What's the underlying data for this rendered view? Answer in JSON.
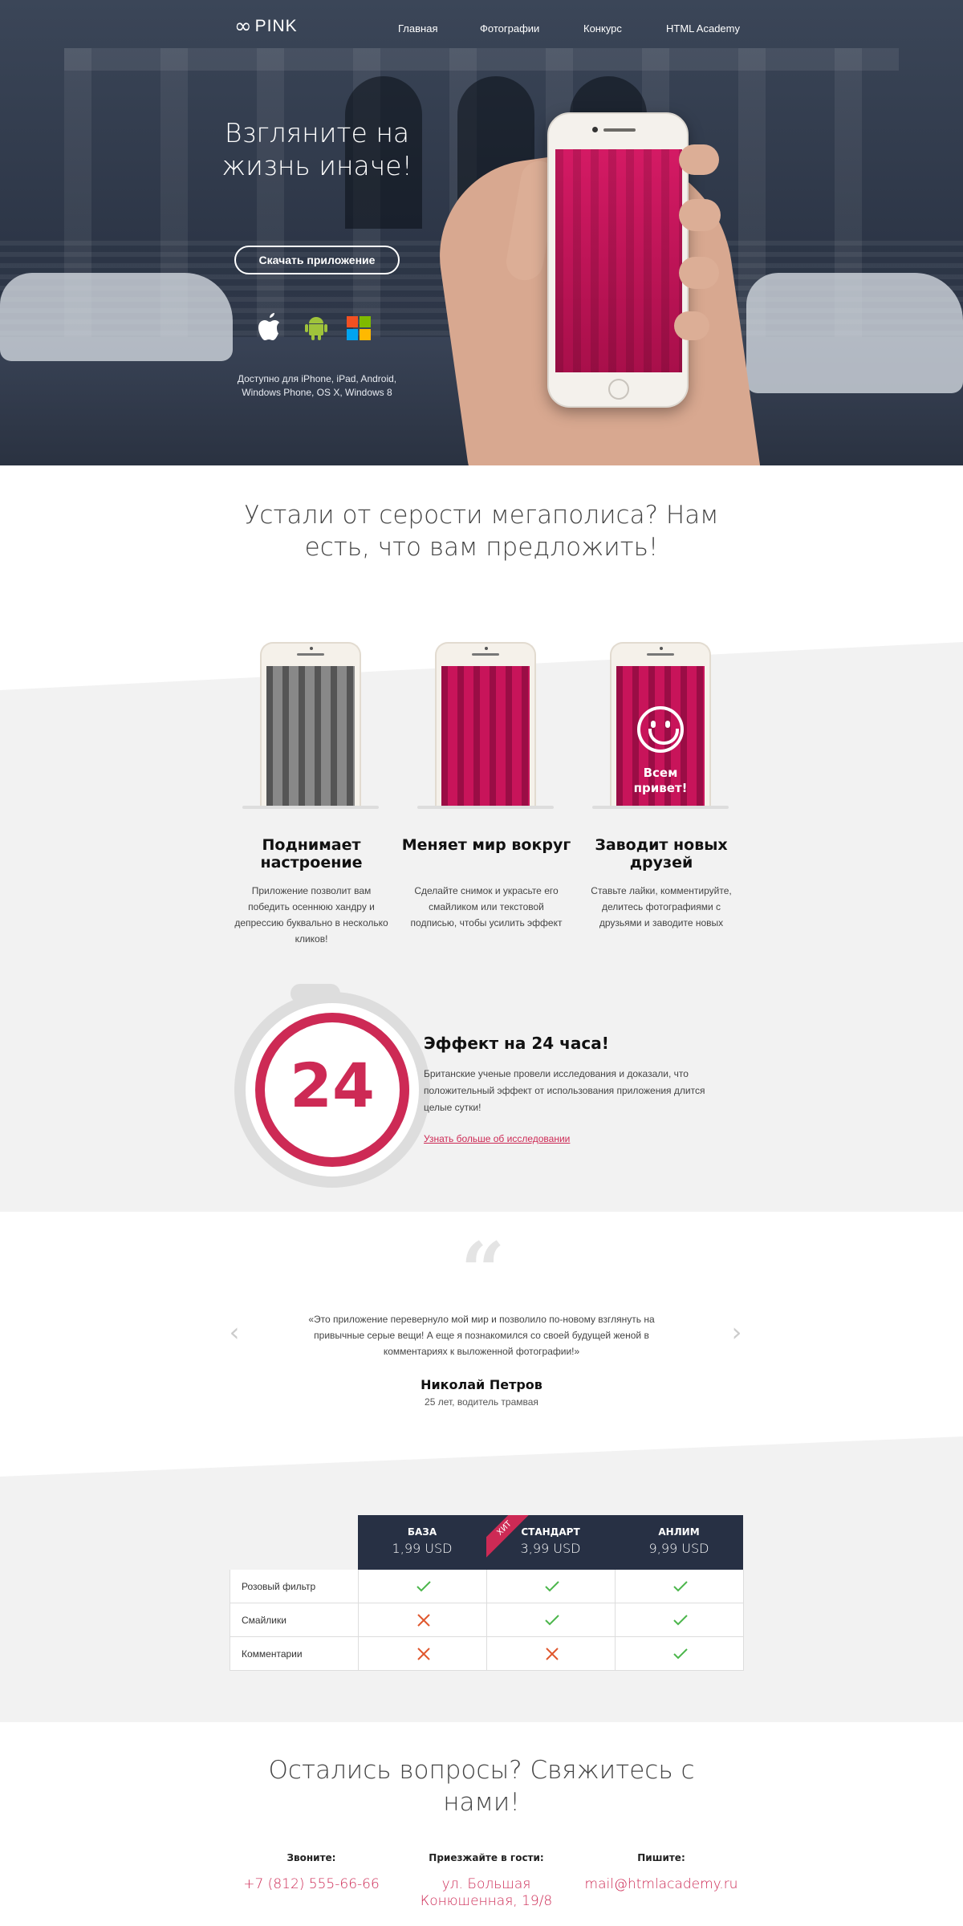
{
  "header": {
    "logo_text": "PINK",
    "nav": [
      "Главная",
      "Фотографии",
      "Конкурс",
      "HTML Academy"
    ]
  },
  "hero": {
    "title": "Взгляните на жизнь иначе!",
    "download_button": "Скачать приложение",
    "availability": "Доступно для iPhone, iPad, Android, Windows Phone, OS X, Windows 8",
    "os_icons": [
      "apple-icon",
      "android-icon",
      "windows-icon"
    ]
  },
  "features": {
    "title": "Устали от серости мегаполиса? Нам есть, что вам предложить!",
    "items": [
      {
        "title": "Поднимает настроение",
        "text": "Приложение позволит вам победить осеннюю хандру и депрессию буквально в несколько кликов!"
      },
      {
        "title": "Меняет мир вокруг",
        "text": "Сделайте снимок и украсьте его смайликом или текстовой подписью, чтобы усилить эффект"
      },
      {
        "title": "Заводит новых друзей",
        "text": "Ставьте лайки, комментируйте, делитесь фотографиями с друзьями и заводите новых"
      }
    ],
    "phone_hello": "Всем привет!"
  },
  "effect": {
    "number": "24",
    "title": "Эффект на 24 часа!",
    "text": "Британские ученые провели исследования и доказали, что положительный эффект от использования приложения длится целые сутки!",
    "link": "Узнать больше об исследовании"
  },
  "review": {
    "text": "«Это приложение перевернуло мой мир и позволило по-новому взглянуть на привычные серые вещи! А еще я познакомился со своей будущей женой в комментариях к выложенной фотографии!»",
    "name": "Николай Петров",
    "role": "25 лет, водитель трамвая"
  },
  "pricing": {
    "plans": [
      {
        "name": "БАЗА",
        "price": "1,99 USD"
      },
      {
        "name": "СТАНДАРТ",
        "price": "3,99 USD",
        "badge": "ХИТ"
      },
      {
        "name": "АНЛИМ",
        "price": "9,99 USD"
      }
    ],
    "rows": [
      {
        "label": "Розовый фильтр",
        "values": [
          true,
          true,
          true
        ]
      },
      {
        "label": "Смайлики",
        "values": [
          false,
          true,
          true
        ]
      },
      {
        "label": "Комментарии",
        "values": [
          false,
          false,
          true
        ]
      }
    ],
    "colors": {
      "check": "#4cb64c",
      "cross": "#e0582e",
      "header": "#273044",
      "accent": "#cd2a55"
    }
  },
  "contacts": {
    "title": "Остались вопросы? Свяжитесь с нами!",
    "items": [
      {
        "head": "Звоните:",
        "value": "+7 (812) 555-66-66"
      },
      {
        "head": "Приезжайте в гости:",
        "value": "ул. Большая Конюшенная, 19/8"
      },
      {
        "head": "Пишите:",
        "value": "mail@htmlacademy.ru"
      }
    ]
  }
}
